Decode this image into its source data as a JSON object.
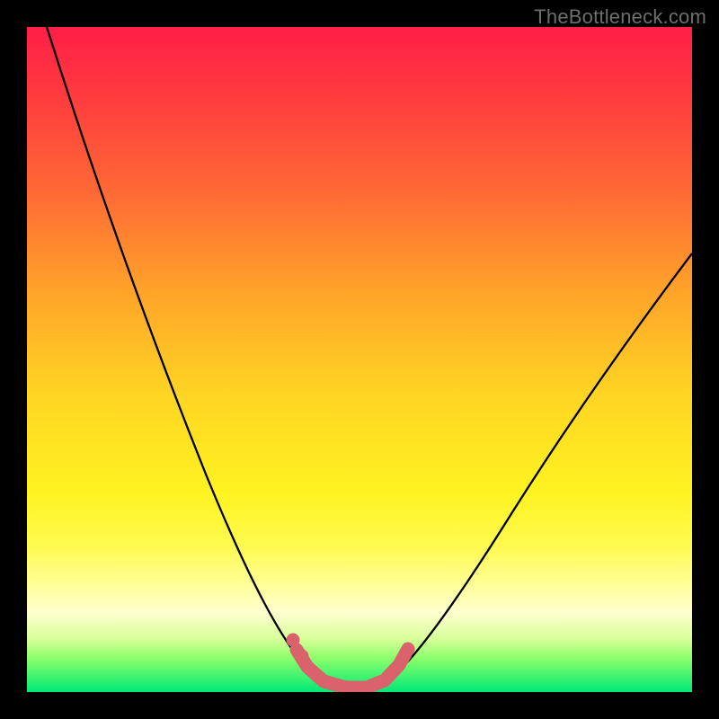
{
  "watermark": "TheBottleneck.com",
  "chart_data": {
    "type": "line",
    "title": "",
    "xlabel": "",
    "ylabel": "",
    "xlim": [
      0,
      100
    ],
    "ylim": [
      0,
      100
    ],
    "grid": false,
    "series": [
      {
        "name": "bottleneck-curve",
        "color": "#000000",
        "x": [
          3,
          7,
          11,
          15,
          19,
          23,
          27,
          31,
          34,
          37,
          40,
          43,
          46,
          49,
          52,
          55,
          60,
          65,
          70,
          75,
          80,
          85,
          90,
          95,
          100
        ],
        "y": [
          100,
          92,
          84,
          76,
          68,
          60,
          51,
          42,
          34,
          26,
          18,
          10,
          4,
          1,
          1,
          4,
          12,
          21,
          29,
          36,
          43,
          49,
          55,
          61,
          66
        ]
      },
      {
        "name": "optimal-region-markers",
        "color": "#d9626c",
        "type": "scatter",
        "x": [
          41.5,
          43,
          45,
          47,
          49,
          51,
          53,
          54.5,
          56
        ],
        "y": [
          7,
          4.5,
          2.2,
          1.2,
          1,
          1.2,
          2.5,
          4.5,
          7
        ]
      }
    ],
    "background_gradient": {
      "direction": "vertical",
      "stops": [
        {
          "pos": 0.0,
          "color": "#ff1f47"
        },
        {
          "pos": 0.25,
          "color": "#ff6a35"
        },
        {
          "pos": 0.55,
          "color": "#ffd423"
        },
        {
          "pos": 0.78,
          "color": "#fffa50"
        },
        {
          "pos": 0.92,
          "color": "#d8ff9a"
        },
        {
          "pos": 1.0,
          "color": "#00e877"
        }
      ]
    }
  }
}
